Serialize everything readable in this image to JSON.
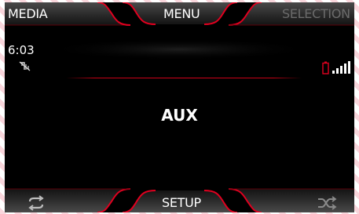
{
  "top_bar": {
    "left_label": "MEDIA",
    "center_label": "MENU",
    "right_label": "SELECTION"
  },
  "status": {
    "time": "6:03"
  },
  "main": {
    "source_label": "AUX"
  },
  "bottom_bar": {
    "center_label": "SETUP",
    "left_icon": "repeat-icon",
    "right_icon": "shuffle-icon"
  },
  "colors": {
    "background": "#000000",
    "accent_red": "#d3001a",
    "inactive_text": "#6b6b6b"
  }
}
